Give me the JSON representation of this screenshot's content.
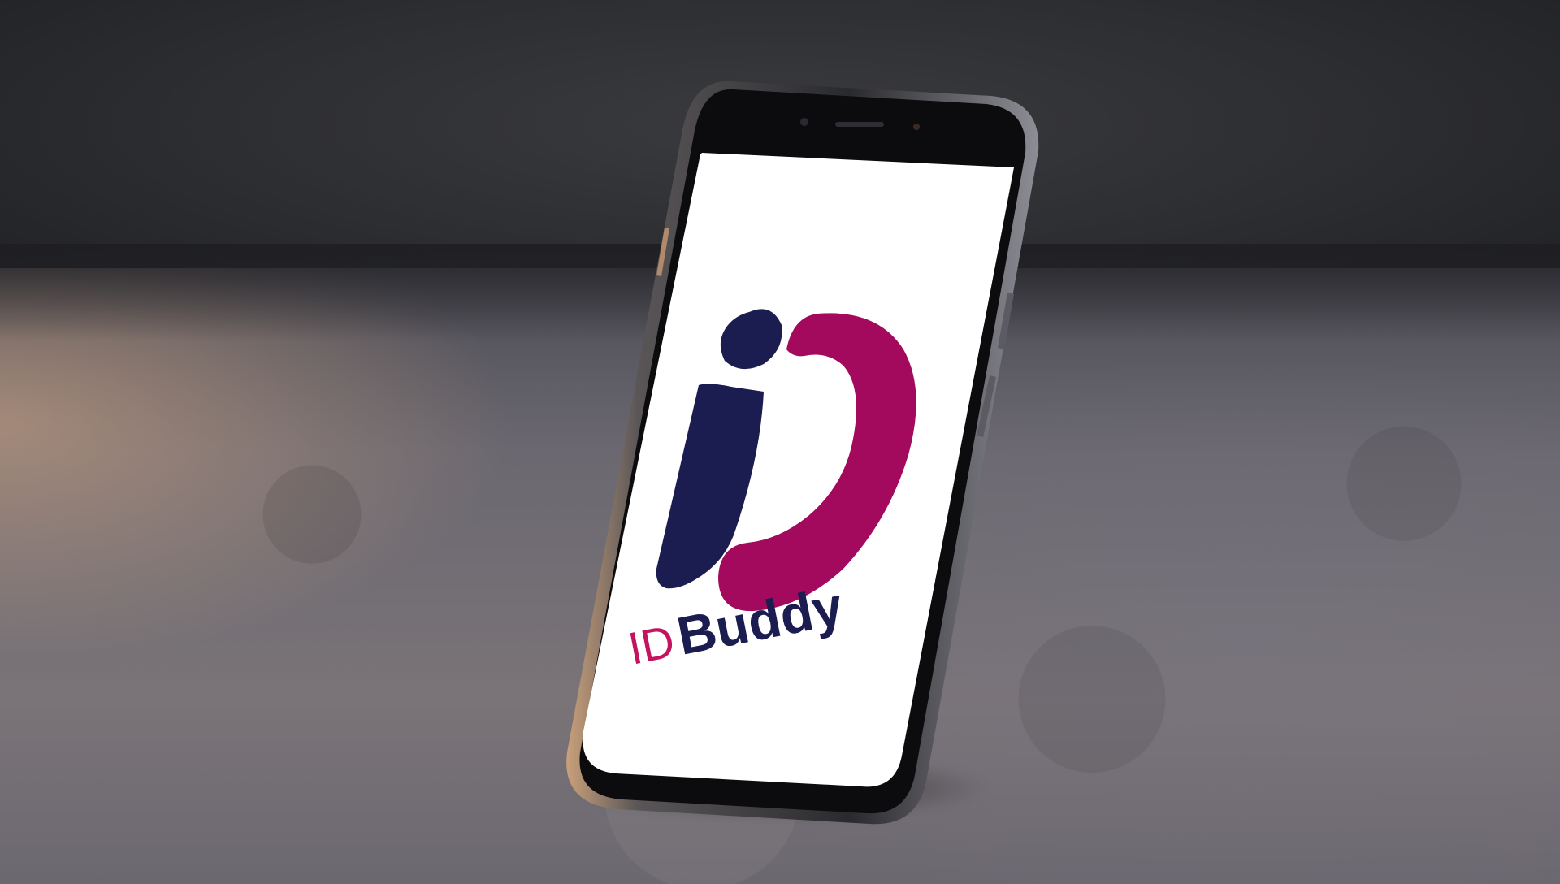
{
  "logo": {
    "prefix": "ID",
    "name": "Buddy"
  },
  "colors": {
    "brand_navy": "#1b1c4f",
    "brand_magenta": "#a3095c",
    "brand_pink_text": "#c4145f",
    "screen_bg": "#ffffff",
    "phone_body": "#1c1c20"
  }
}
